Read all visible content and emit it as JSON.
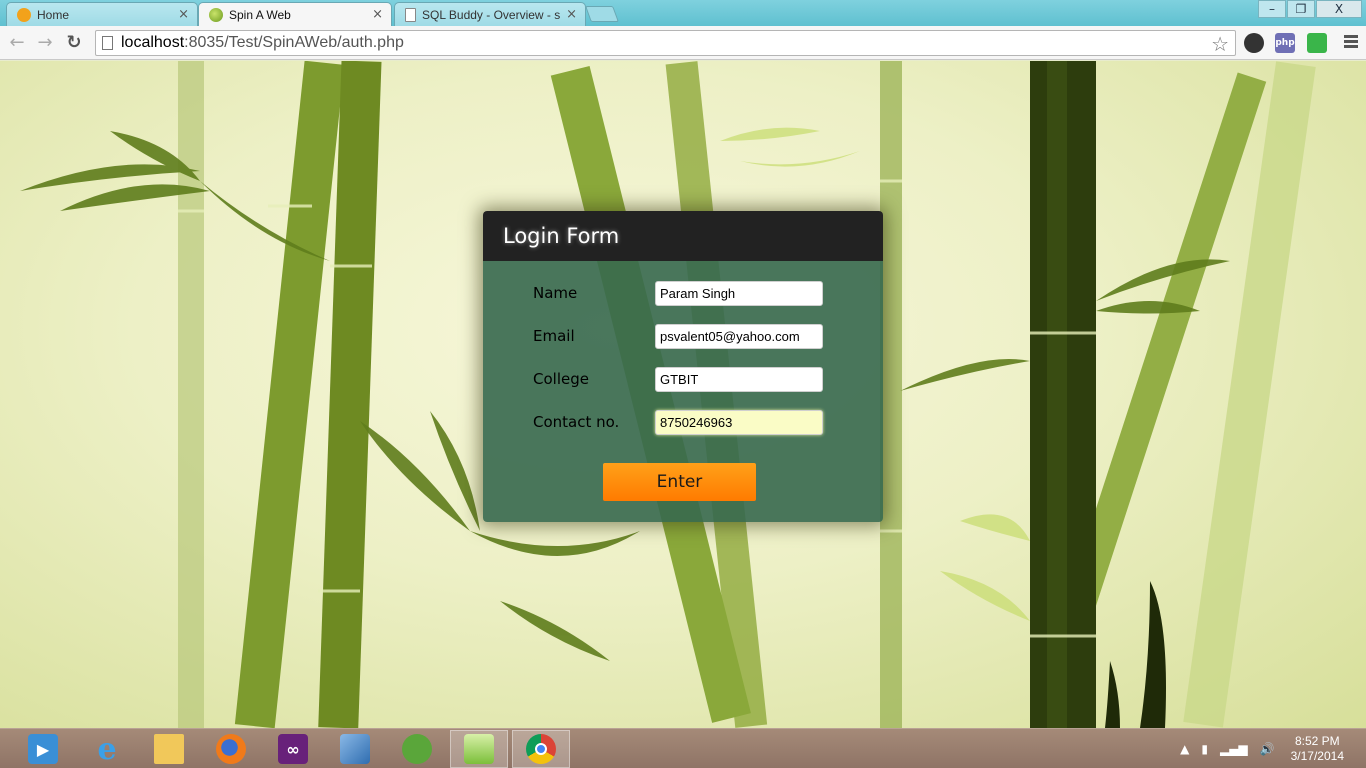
{
  "browser": {
    "tabs": [
      {
        "title": "Home",
        "active": false
      },
      {
        "title": "Spin A Web",
        "active": true
      },
      {
        "title": "SQL Buddy - Overview - s",
        "active": false
      }
    ],
    "url_host": "localhost",
    "url_rest": ":8035/Test/SpinAWeb/auth.php",
    "window_controls": {
      "minimize": "–",
      "restore": "❐",
      "close": "X"
    },
    "extensions": [
      "circle-extension-icon",
      "php-extension-icon",
      "green-extension-icon"
    ],
    "php_label": "php"
  },
  "login": {
    "title": "Login Form",
    "fields": {
      "name": {
        "label": "Name",
        "value": "Param Singh"
      },
      "email": {
        "label": "Email",
        "value": "psvalent05@yahoo.com"
      },
      "college": {
        "label": "College",
        "value": "GTBIT"
      },
      "contact": {
        "label": "Contact no.",
        "value": "8750246963"
      }
    },
    "submit_label": "Enter"
  },
  "taskbar": {
    "apps": [
      "media-player",
      "internet-explorer",
      "file-explorer",
      "firefox",
      "visual-studio",
      "virtualbox",
      "evernote",
      "notepad-plus",
      "chrome"
    ],
    "time": "8:52 PM",
    "date": "3/17/2014"
  },
  "colors": {
    "form_header": "#222222",
    "form_body": "#36684e",
    "button": "#ff8a0a",
    "focused_input": "#fafcc6"
  }
}
